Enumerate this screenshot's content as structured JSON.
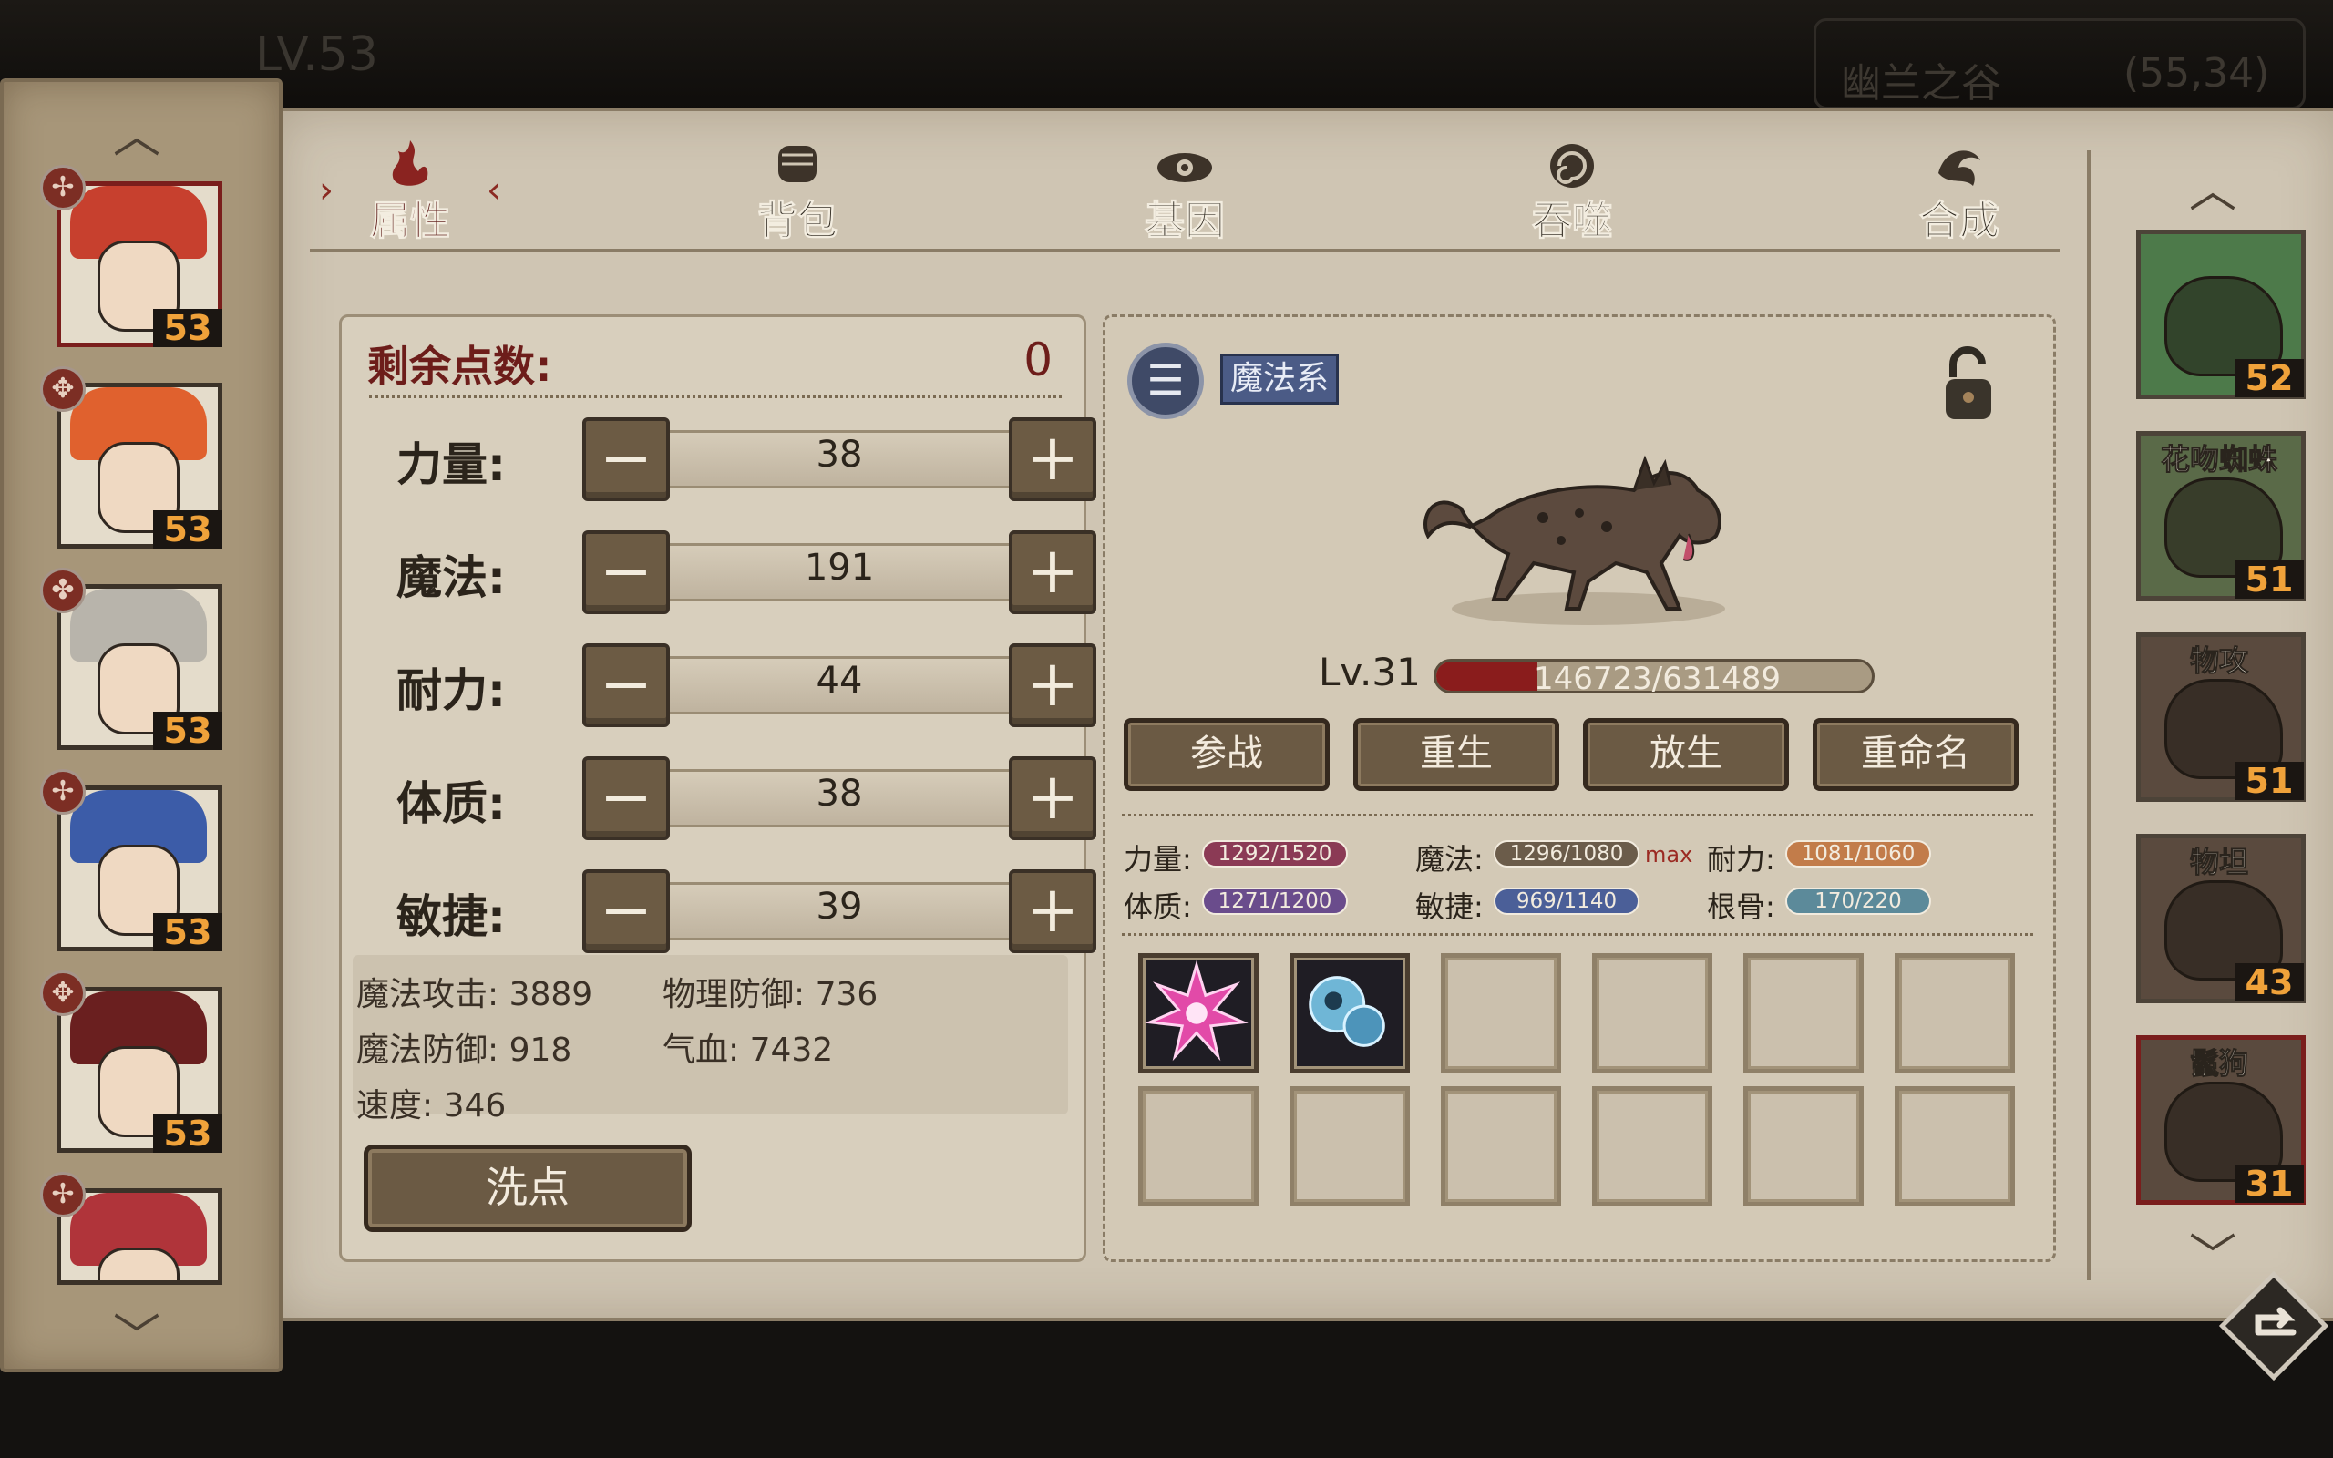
{
  "header": {
    "player_level": "LV.53",
    "location_name": "幽兰之谷",
    "location_coords": "(55,34)"
  },
  "tabs": [
    {
      "label": "属性",
      "icon": "flame-icon",
      "active": true
    },
    {
      "label": "背包",
      "icon": "fist-icon",
      "active": false
    },
    {
      "label": "基因",
      "icon": "eye-icon",
      "active": false
    },
    {
      "label": "吞噬",
      "icon": "swirl-icon",
      "active": false
    },
    {
      "label": "合成",
      "icon": "fusion-icon",
      "active": false
    }
  ],
  "heroes": [
    {
      "level": "53",
      "badge": "✢",
      "active": true
    },
    {
      "level": "53",
      "badge": "✥",
      "active": false
    },
    {
      "level": "53",
      "badge": "✤",
      "active": false
    },
    {
      "level": "53",
      "badge": "✢",
      "active": false
    },
    {
      "level": "53",
      "badge": "✥",
      "active": false
    },
    {
      "level": "",
      "badge": "✢",
      "active": false
    }
  ],
  "attributes": {
    "remaining_label": "剩余点数:",
    "remaining_value": "0",
    "rows": [
      {
        "name": "力量:",
        "value": "38"
      },
      {
        "name": "魔法:",
        "value": "191"
      },
      {
        "name": "耐力:",
        "value": "44"
      },
      {
        "name": "体质:",
        "value": "38"
      },
      {
        "name": "敏捷:",
        "value": "39"
      }
    ],
    "derived": {
      "magic_attack": "魔法攻击: 3889",
      "phys_defense": "物理防御: 736",
      "magic_defense": "魔法防御: 918",
      "hp": "气血: 7432",
      "speed": "速度: 346"
    },
    "reset_label": "洗点"
  },
  "pet": {
    "type_badge": "魔法系",
    "level": "Lv.31",
    "exp_text": "146723/631489",
    "exp_fraction": 0.232,
    "actions": [
      "参战",
      "重生",
      "放生",
      "重命名"
    ],
    "stats": [
      {
        "label": "力量:",
        "value": "1292/1520",
        "color": "#8b3a55"
      },
      {
        "label": "魔法:",
        "value": "1296/1080",
        "color": "#6b5c4a",
        "max": "max"
      },
      {
        "label": "耐力:",
        "value": "1081/1060",
        "color": "#c27c4a"
      },
      {
        "label": "体质:",
        "value": "1271/1200",
        "color": "#6a4c8c"
      },
      {
        "label": "敏捷:",
        "value": "969/1140",
        "color": "#4b5f98"
      },
      {
        "label": "根骨:",
        "value": "170/220",
        "color": "#5c8a9a"
      }
    ],
    "skills": [
      "starburst-skill-icon",
      "water-orb-skill-icon"
    ],
    "slot_count": 12
  },
  "pet_roster": [
    {
      "name": "",
      "level": "52",
      "active": false,
      "color": "#4d7a4a"
    },
    {
      "name": "花吻蜘蛛",
      "level": "51",
      "active": false,
      "color": "#5a6a48"
    },
    {
      "name": "物攻",
      "level": "51",
      "active": false,
      "color": "#5a4a3e"
    },
    {
      "name": "物坦",
      "level": "43",
      "active": false,
      "color": "#5a4a3e"
    },
    {
      "name": "鬣狗",
      "level": "31",
      "active": true,
      "color": "#5a4a3e"
    }
  ]
}
